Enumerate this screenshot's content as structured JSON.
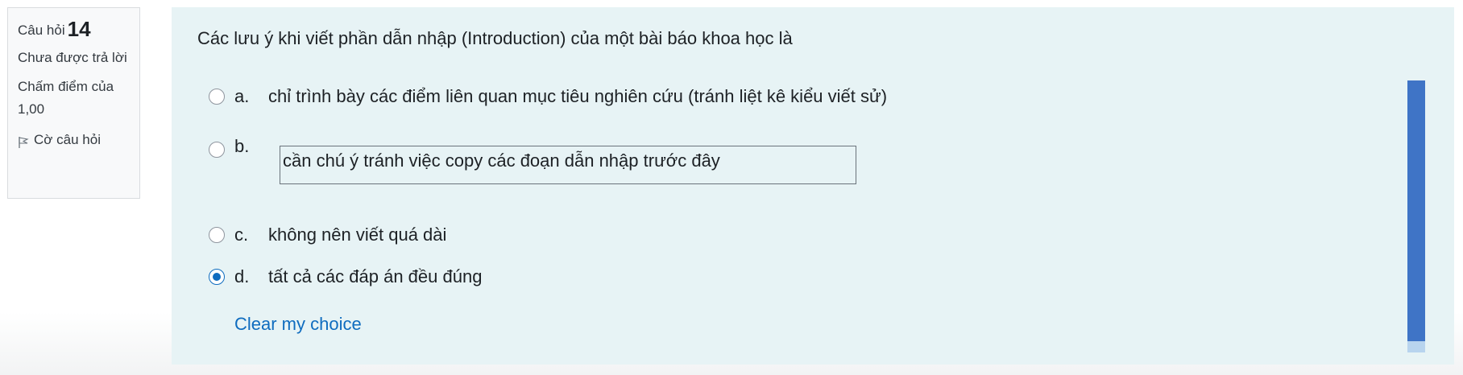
{
  "info": {
    "question_label": "Câu hỏi",
    "question_number": "14",
    "status": "Chưa được trả lời",
    "grade": "Chấm điểm của 1,00",
    "flag_label": "Cờ câu hỏi",
    "flag_icon": "flag-icon"
  },
  "question": {
    "text": "Các lưu ý khi viết phần dẫn nhập (Introduction) của một bài báo khoa học là",
    "answers": [
      {
        "letter": "a.",
        "text": "chỉ trình bày các điểm liên quan mục tiêu nghiên cứu (tránh liệt kê kiểu viết sử)",
        "selected": false
      },
      {
        "letter": "b.",
        "text": "cần chú ý tránh việc copy các đoạn dẫn nhập trước đây",
        "selected": false
      },
      {
        "letter": "c.",
        "text": "không nên viết quá dài",
        "selected": false
      },
      {
        "letter": "d.",
        "text": "tất cả các đáp án đều đúng",
        "selected": true
      }
    ],
    "clear_label": "Clear my choice"
  },
  "colors": {
    "panel_background": "#e7f3f5",
    "link": "#0f6cbf",
    "scrollbar_thumb": "#3f74c6"
  }
}
